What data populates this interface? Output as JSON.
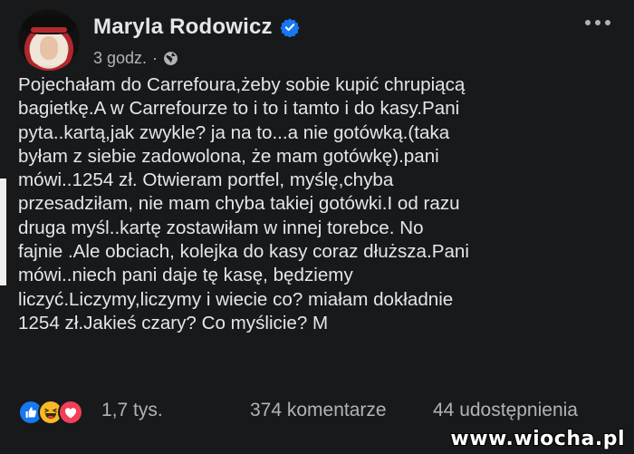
{
  "post": {
    "author": "Maryla Rodowicz",
    "time": "3 godz.",
    "separator": "·",
    "text": "Pojechałam do Carrefoura,żeby sobie kupić chrupiącą\nbagietkę.A w Carrefourze to i to i tamto i do kasy.Pani\npyta..kartą,jak zwykle? ja na to...a nie gotówką.(taka\nbyłam z siebie zadowolona, że mam gotówkę).pani\nmówi..1254 zł. Otwieram portfel, myślę,chyba\nprzesadziłam, nie mam chyba takiej gotówki.I od razu\ndruga myśl..kartę zostawiłam w innej torebce. No\nfajnie .Ale obciach, kolejka do kasy coraz dłuższa.Pani\nmówi..niech pani daje tę kasę, będziemy\nliczyć.Liczymy,liczymy i wiecie co? miałam dokładnie\n1254 zł.Jakieś czary? Co myślicie? M"
  },
  "footer": {
    "reactions_count": "1,7 tys.",
    "comments": "374 komentarze",
    "shares": "44 udostępnienia"
  },
  "watermark": "www.wiocha.pl",
  "colors": {
    "background": "#18191a",
    "text": "#e4e6eb",
    "secondary": "#b0b3b8",
    "verified": "#1877f2",
    "like": "#1877f2",
    "haha": "#f7b928",
    "love": "#f33e58"
  },
  "icons": [
    "verified-icon",
    "globe-icon",
    "more-icon",
    "like-icon",
    "haha-icon",
    "love-icon"
  ]
}
